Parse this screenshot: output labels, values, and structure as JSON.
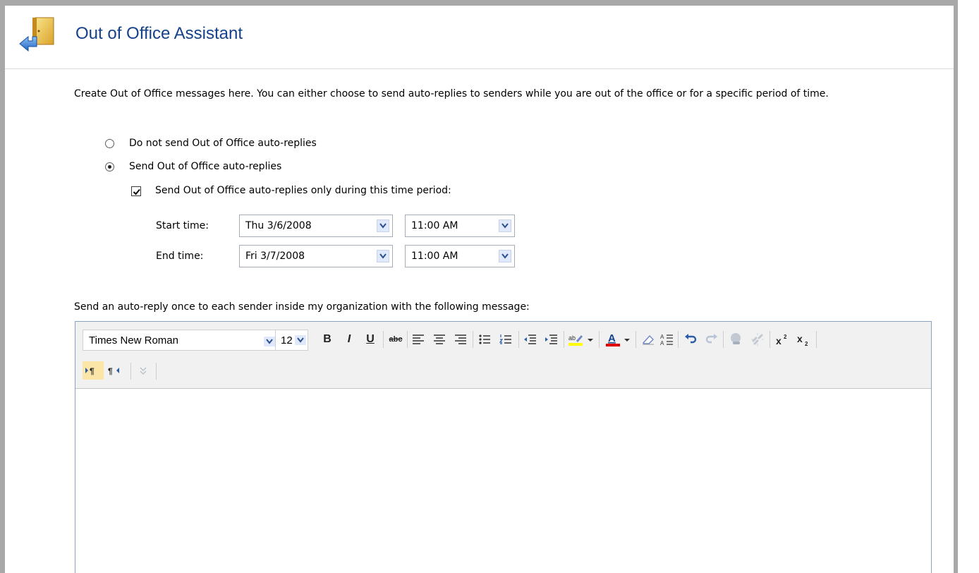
{
  "page": {
    "title": "Out of Office Assistant",
    "description": "Create Out of Office messages here. You can either choose to send auto-replies to senders while you are out of the office or for a specific period of time."
  },
  "options": {
    "no_reply_label": "Do not send Out of Office auto-replies",
    "send_reply_label": "Send Out of Office auto-replies",
    "selected": "send",
    "time_period_label": "Send Out of Office auto-replies only during this time period:",
    "time_period_checked": true
  },
  "schedule": {
    "start_label": "Start time:",
    "start_date": "Thu 3/6/2008",
    "start_time": "11:00 AM",
    "end_label": "End time:",
    "end_date": "Fri 3/7/2008",
    "end_time": "11:00 AM"
  },
  "message": {
    "label": "Send an auto-reply once to each sender inside my organization with the following message:"
  },
  "toolbar": {
    "font_name": "Times New Roman",
    "font_size": "12",
    "buttons": [
      "bold",
      "italic",
      "underline",
      "strikethrough",
      "align-left",
      "align-center",
      "align-right",
      "bullets",
      "numbering",
      "decrease-indent",
      "increase-indent",
      "highlight",
      "font-color",
      "clear-formatting",
      "paragraph-spacing",
      "undo",
      "redo",
      "insert-link",
      "remove-link",
      "superscript",
      "subscript",
      "left-to-right",
      "right-to-left",
      "more"
    ]
  },
  "colors": {
    "title": "#15428b",
    "highlight": "#ffff00",
    "font_color": "#e00000"
  }
}
